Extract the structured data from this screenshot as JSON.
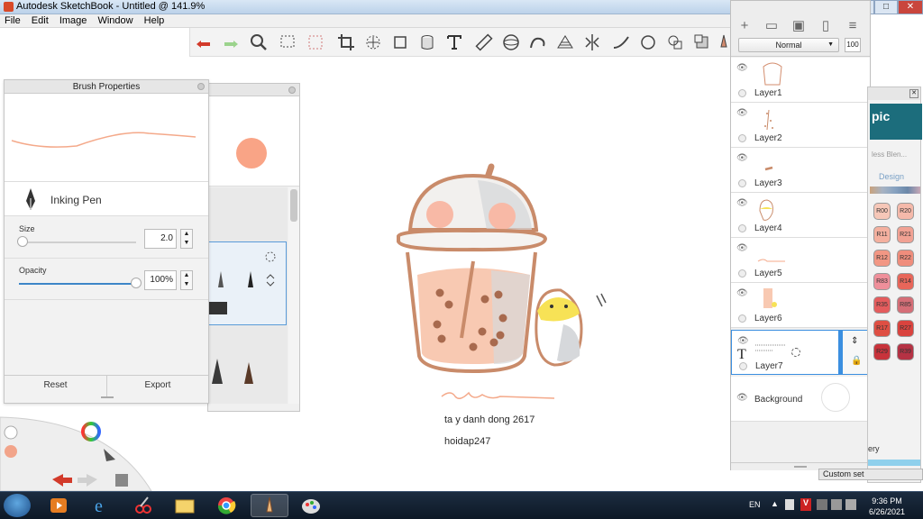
{
  "window": {
    "title": "Autodesk SketchBook - Untitled @ 141.9%"
  },
  "menu": [
    "File",
    "Edit",
    "Image",
    "Window",
    "Help"
  ],
  "toolbar": {
    "tools": [
      "undo-icon",
      "redo-icon",
      "zoom-icon",
      "selection-icon",
      "crop-select-icon",
      "crop-icon",
      "distort-icon",
      "transform-icon",
      "fill-icon",
      "text-icon",
      "ruler-icon",
      "ellipse-guide-icon",
      "french-curve-icon",
      "perspective-icon",
      "symmetry-icon",
      "stroke-icon",
      "shape-icon",
      "layer-copy-icon",
      "copic-icon",
      "brush-icon"
    ]
  },
  "brush_properties": {
    "title": "Brush Properties",
    "brush_name": "Inking Pen",
    "size_label": "Size",
    "size_value": "2.0",
    "size_fraction": 0.03,
    "opacity_label": "Opacity",
    "opacity_value": "100%",
    "opacity_fraction": 1.0,
    "reset_label": "Reset",
    "export_label": "Export",
    "stroke_color": "#f4a98a"
  },
  "brush_library": {
    "current_color": "#f9a486"
  },
  "layers": {
    "blend_mode": "Normal",
    "opacity": "100",
    "items": [
      {
        "name": "Layer1"
      },
      {
        "name": "Layer2"
      },
      {
        "name": "Layer3"
      },
      {
        "name": "Layer4"
      },
      {
        "name": "Layer5"
      },
      {
        "name": "Layer6"
      },
      {
        "name": "Layer7",
        "selected": true
      },
      {
        "name": "Background"
      }
    ]
  },
  "copic": {
    "logo_text": "pic",
    "sub_text": "less Blen...",
    "design_label": "Design",
    "colors": [
      {
        "code": "R00",
        "hex": "#f6c7b8"
      },
      {
        "code": "R20",
        "hex": "#f5b9aa"
      },
      {
        "code": "R11",
        "hex": "#f4b09f"
      },
      {
        "code": "R21",
        "hex": "#f1a193"
      },
      {
        "code": "R12",
        "hex": "#f29784"
      },
      {
        "code": "R22",
        "hex": "#ef8d7c"
      },
      {
        "code": "R83",
        "hex": "#ef8f9a"
      },
      {
        "code": "R14",
        "hex": "#e8665a"
      },
      {
        "code": "R35",
        "hex": "#e45c5d"
      },
      {
        "code": "R85",
        "hex": "#d56e77"
      },
      {
        "code": "R17",
        "hex": "#df4f43"
      },
      {
        "code": "R27",
        "hex": "#d9433e"
      },
      {
        "code": "R29",
        "hex": "#c8333b"
      },
      {
        "code": "R39",
        "hex": "#b53244"
      }
    ],
    "gallery_label": "ery",
    "custom_set_label": "Custom set"
  },
  "drawing": {
    "caption_line1": "ta y danh dong 2617",
    "caption_line2": "hoidap247"
  },
  "taskbar": {
    "lang": "EN",
    "time": "9:36 PM",
    "date": "6/26/2021"
  }
}
